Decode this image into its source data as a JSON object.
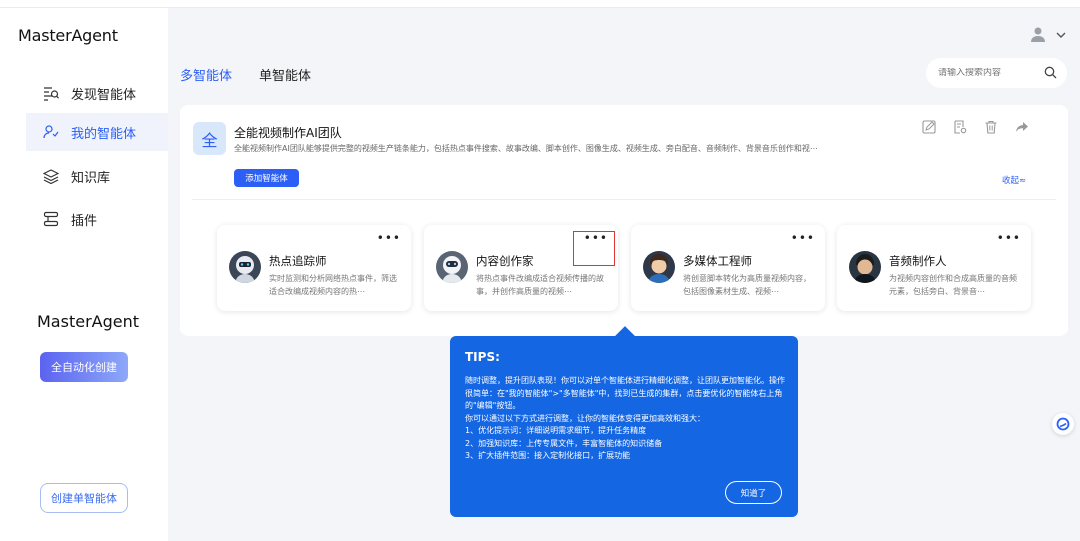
{
  "brand": "MasterAgent",
  "sidebar": {
    "items": [
      {
        "label": "发现智能体",
        "icon": "discover-icon"
      },
      {
        "label": "我的智能体",
        "icon": "user-agent-icon"
      },
      {
        "label": "知识库",
        "icon": "layers-icon"
      },
      {
        "label": "插件",
        "icon": "plugin-icon"
      }
    ],
    "brand2": "MasterAgent",
    "auto_create": "全自动化创建",
    "create_single": "创建单智能体"
  },
  "tabs": [
    "多智能体",
    "单智能体"
  ],
  "search": {
    "placeholder": "请输入搜索内容"
  },
  "team": {
    "badge": "全",
    "title": "全能视频制作AI团队",
    "desc": "全能视频制作AI团队能够提供完整的视频生产链条能力，包括热点事件搜索、故事改编、脚本创作、图像生成、视频生成、旁白配音、音频制作、背景音乐创作和视⋯",
    "add_button": "添加智能体",
    "collapse": "收起≈"
  },
  "agents": [
    {
      "name": "热点追踪师",
      "desc": "实时监测和分析网络热点事件，筛选适合改编成视频内容的热⋯"
    },
    {
      "name": "内容创作家",
      "desc": "将热点事件改编成适合视频传播的故事，并创作高质量的视频⋯"
    },
    {
      "name": "多媒体工程师",
      "desc": "将创意脚本转化为高质量视频内容，包括图像素材生成、视频⋯"
    },
    {
      "name": "音频制作人",
      "desc": "为视频内容创作和合成高质量的音频元素，包括旁白、背景音⋯"
    }
  ],
  "tips": {
    "title": "TIPS:",
    "lines": [
      "随时调整，提升团队表现！你可以对单个智能体进行精细化调整，让团队更加智能化。操作很简单：在\"我的智能体\">\"多智能体\"中，找到已生成的集群，点击要优化的智能体右上角的\"编辑\"按钮。",
      "你可以通过以下方式进行调整，让你的智能体变得更加高效和强大：",
      "1、优化提示词：详细说明需求细节，提升任务精度",
      "2、加强知识库：上传专属文件，丰富智能体的知识储备",
      "3、扩大插件范围：接入定制化接口，扩展功能"
    ],
    "button": "知道了"
  }
}
